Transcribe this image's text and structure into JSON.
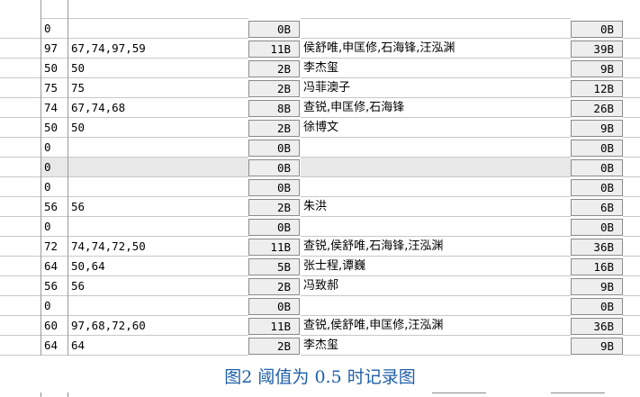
{
  "table": {
    "rows": [
      {
        "a": "0",
        "b": "",
        "c": "0B",
        "d": "",
        "e": "0B",
        "grey": false
      },
      {
        "a": "97",
        "b": "67,74,97,59",
        "c": "11B",
        "d": "侯舒唯,申匡修,石海锋,汪泓渊",
        "e": "39B",
        "grey": false
      },
      {
        "a": "50",
        "b": "50",
        "c": "2B",
        "d": "李杰玺",
        "e": "9B",
        "grey": false
      },
      {
        "a": "75",
        "b": "75",
        "c": "2B",
        "d": "冯菲澳子",
        "e": "12B",
        "grey": false
      },
      {
        "a": "74",
        "b": "67,74,68",
        "c": "8B",
        "d": "查锐,申匡修,石海锋",
        "e": "26B",
        "grey": false
      },
      {
        "a": "50",
        "b": "50",
        "c": "2B",
        "d": "徐博文",
        "e": "9B",
        "grey": false
      },
      {
        "a": "0",
        "b": "",
        "c": "0B",
        "d": "",
        "e": "0B",
        "grey": false
      },
      {
        "a": "0",
        "b": "",
        "c": "0B",
        "d": "",
        "e": "0B",
        "grey": true
      },
      {
        "a": "0",
        "b": "",
        "c": "0B",
        "d": "",
        "e": "0B",
        "grey": false
      },
      {
        "a": "56",
        "b": "56",
        "c": "2B",
        "d": "朱洪",
        "e": "6B",
        "grey": false
      },
      {
        "a": "0",
        "b": "",
        "c": "0B",
        "d": "",
        "e": "0B",
        "grey": false
      },
      {
        "a": "72",
        "b": "74,74,72,50",
        "c": "11B",
        "d": "查锐,侯舒唯,石海锋,汪泓渊",
        "e": "36B",
        "grey": false
      },
      {
        "a": "64",
        "b": "50,64",
        "c": "5B",
        "d": "张士程,谭巍",
        "e": "16B",
        "grey": false
      },
      {
        "a": "56",
        "b": "56",
        "c": "2B",
        "d": "冯致郝",
        "e": "9B",
        "grey": false
      },
      {
        "a": "0",
        "b": "",
        "c": "0B",
        "d": "",
        "e": "0B",
        "grey": false
      },
      {
        "a": "60",
        "b": "97,68,72,60",
        "c": "11B",
        "d": "查锐,侯舒唯,申匡修,汪泓渊",
        "e": "36B",
        "grey": false
      },
      {
        "a": "64",
        "b": "64",
        "c": "2B",
        "d": "李杰玺",
        "e": "9B",
        "grey": false
      }
    ]
  },
  "caption": "图2 阈值为 0.5 时记录图",
  "colors": {
    "caption": "#1f5fa8",
    "grey_row": "#e8e8e8"
  }
}
